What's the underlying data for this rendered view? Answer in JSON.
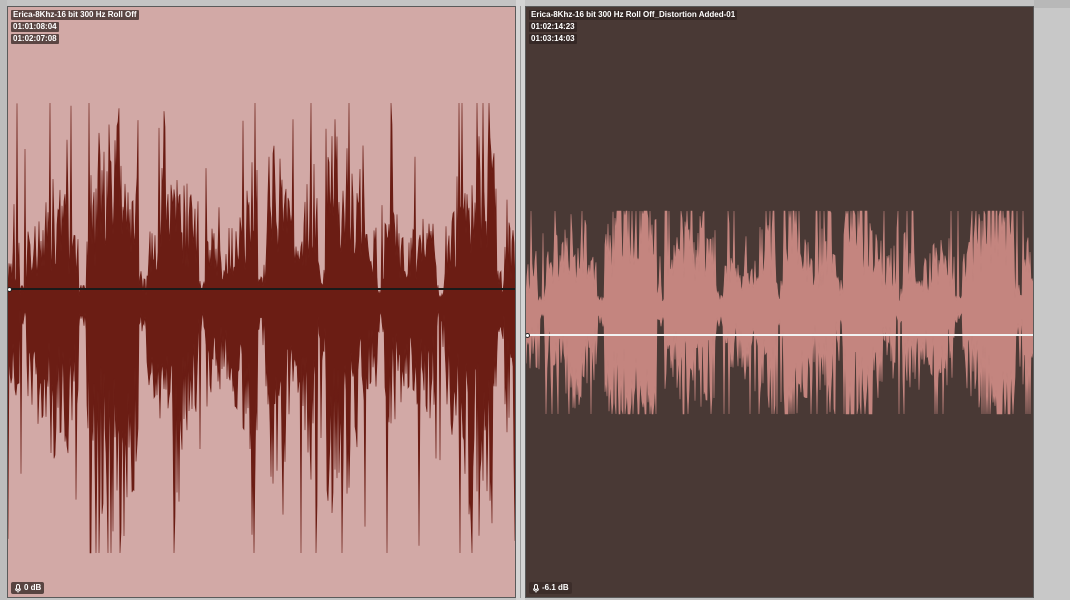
{
  "colors": {
    "clip_a_background": "#d2a9a6",
    "clip_a_waveform": "#6b1d14",
    "clip_a_gain_line": "#1a1a1a",
    "clip_b_background": "#493935",
    "clip_b_waveform": "#c4857f",
    "clip_b_gain_line": "#f2f2f2"
  },
  "clips": [
    {
      "name": "Erica-8Khz-16 bit 300 Hz Roll Off",
      "start": "01:01:08:04",
      "end": "01:02:07:08",
      "gain": "0 dB",
      "gain_icon": "microphone-icon"
    },
    {
      "name": "Erica-8Khz-16 bit 300 Hz Roll Off_Distortion Added-01",
      "start": "01:02:14:23",
      "end": "01:03:14:03",
      "gain": "-6.1 dB",
      "gain_icon": "microphone-icon"
    }
  ]
}
